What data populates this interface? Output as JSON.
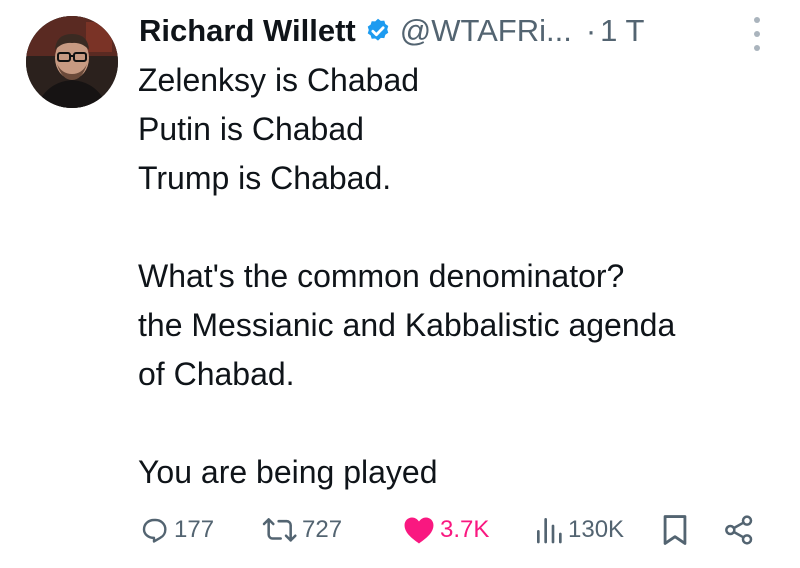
{
  "author": {
    "name": "Richard Willett",
    "handle": "@WTAFRi...",
    "separator": "·",
    "time": "1 T"
  },
  "tweet": {
    "lines": [
      "Zelenksy is Chabad",
      "Putin is Chabad",
      "Trump is Chabad.",
      "",
      "What's the common denominator?",
      "the Messianic and Kabbalistic agenda",
      "of Chabad.",
      "",
      "You are being played"
    ]
  },
  "actions": {
    "reply_count": "177",
    "retweet_count": "727",
    "like_count": "3.7K",
    "views_count": "130K"
  },
  "colors": {
    "text": "#0f1419",
    "secondary": "#536471",
    "verified": "#1d9bf0",
    "like": "#f91880"
  },
  "icons": [
    "verified-badge-icon",
    "more-options-icon",
    "reply-icon",
    "retweet-icon",
    "heart-icon",
    "views-icon",
    "bookmark-icon",
    "share-icon"
  ]
}
